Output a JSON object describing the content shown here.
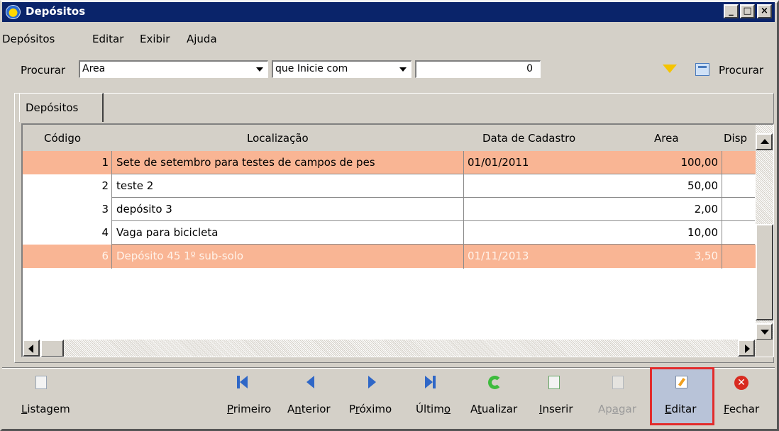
{
  "window": {
    "title": "Depósitos",
    "controls": [
      "_",
      "□",
      "×"
    ]
  },
  "menu": [
    "Depósitos",
    "Editar",
    "Exibir",
    "Ajuda"
  ],
  "search": {
    "label": "Procurar",
    "field_value": "Area",
    "operator_value": "que Inicie com",
    "input_value": "0",
    "button_label": "Procurar"
  },
  "tab": {
    "label": "Depósitos"
  },
  "table": {
    "columns": [
      "Código",
      "Localização",
      "Data de Cadastro",
      "Area",
      "Disp"
    ],
    "rows": [
      {
        "codigo": "1",
        "localizacao": "Sete de setembro para  testes de campos de pes",
        "data": "01/01/2011",
        "area": "100,00",
        "state": "selected"
      },
      {
        "codigo": "2",
        "localizacao": "teste 2",
        "data": "",
        "area": "50,00",
        "state": "normal"
      },
      {
        "codigo": "3",
        "localizacao": "depósito 3",
        "data": "",
        "area": "2,00",
        "state": "normal"
      },
      {
        "codigo": "4",
        "localizacao": "Vaga para bicicleta",
        "data": "",
        "area": "10,00",
        "state": "normal"
      },
      {
        "codigo": "6",
        "localizacao": "Depósito 45 1º sub-solo",
        "data": "01/11/2013",
        "area": "3,50",
        "state": "selected-light"
      }
    ]
  },
  "toolbar": {
    "listagem": {
      "label": "Listagem",
      "u": "L",
      "rest": "istagem"
    },
    "primeiro": {
      "label": "Primeiro",
      "u": "P",
      "rest": "rimeiro"
    },
    "anterior": {
      "label": "Anterior",
      "pre": "A",
      "u": "n",
      "rest": "terior"
    },
    "proximo": {
      "label": "Próximo",
      "pre": "P",
      "u": "r",
      "rest": "óximo"
    },
    "ultimo": {
      "label": "Último",
      "pre": "Últim",
      "u": "o",
      "rest": ""
    },
    "atualizar": {
      "label": "Atualizar",
      "pre": "A",
      "u": "t",
      "rest": "ualizar"
    },
    "inserir": {
      "label": "Inserir",
      "u": "I",
      "rest": "nserir"
    },
    "apagar": {
      "label": "Apagar",
      "pre": "Ap",
      "u": "a",
      "rest": "gar"
    },
    "editar": {
      "label": "Editar",
      "u": "E",
      "rest": "ditar"
    },
    "fechar": {
      "label": "Fechar",
      "u": "F",
      "rest": "echar"
    }
  },
  "colors": {
    "title_bar": "#0a246a",
    "selected_row": "#f9b594",
    "highlight_box": "#e22b2b"
  }
}
